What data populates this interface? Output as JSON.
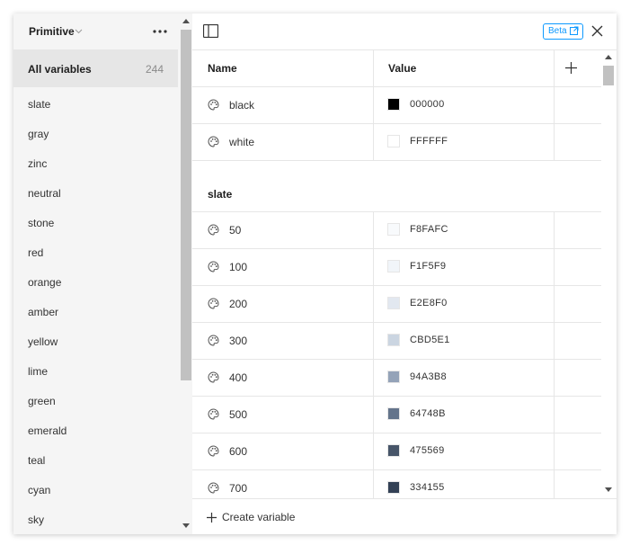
{
  "sidebar": {
    "collection": "Primitive",
    "all_variables_label": "All variables",
    "all_variables_count": "244",
    "groups": [
      "slate",
      "gray",
      "zinc",
      "neutral",
      "stone",
      "red",
      "orange",
      "amber",
      "yellow",
      "lime",
      "green",
      "emerald",
      "teal",
      "cyan",
      "sky"
    ]
  },
  "header": {
    "badge_label": "Beta"
  },
  "table": {
    "columns": {
      "name": "Name",
      "value": "Value"
    },
    "ungrouped_rows": [
      {
        "name": "black",
        "value": "000000",
        "color": "#000000"
      },
      {
        "name": "white",
        "value": "FFFFFF",
        "color": "#FFFFFF"
      }
    ],
    "group_title": "slate",
    "group_rows": [
      {
        "name": "50",
        "value": "F8FAFC",
        "color": "#F8FAFC"
      },
      {
        "name": "100",
        "value": "F1F5F9",
        "color": "#F1F5F9"
      },
      {
        "name": "200",
        "value": "E2E8F0",
        "color": "#E2E8F0"
      },
      {
        "name": "300",
        "value": "CBD5E1",
        "color": "#CBD5E1"
      },
      {
        "name": "400",
        "value": "94A3B8",
        "color": "#94A3B8"
      },
      {
        "name": "500",
        "value": "64748B",
        "color": "#64748B"
      },
      {
        "name": "600",
        "value": "475569",
        "color": "#475569"
      },
      {
        "name": "700",
        "value": "334155",
        "color": "#334155"
      }
    ]
  },
  "footer": {
    "create_label": "Create variable"
  },
  "colors": {
    "accent": "#0d99ff",
    "sidebar_bg": "#f5f5f5",
    "selected_bg": "#e6e6e6",
    "border": "#e6e6e6"
  },
  "icons": {
    "variable_type": "palette-icon",
    "panel_toggle": "sidebar-panel-icon",
    "close": "close-icon",
    "add": "plus-icon",
    "more": "more-horizontal-icon",
    "external": "external-link-icon"
  }
}
